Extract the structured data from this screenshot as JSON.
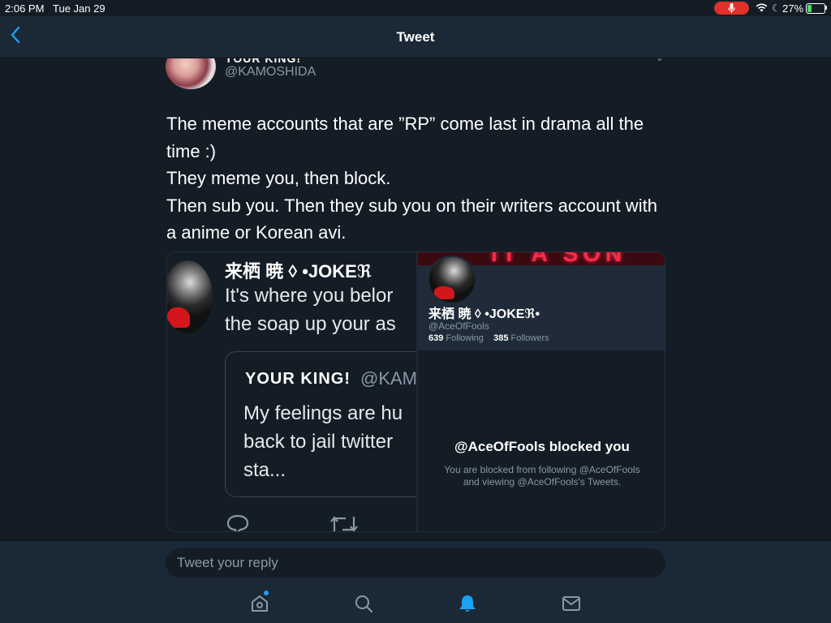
{
  "status_bar": {
    "time": "2:06 PM",
    "date": "Tue Jan 29",
    "battery_percent": "27%",
    "battery_level": 0.27,
    "icons": [
      "microphone-icon",
      "wifi-icon",
      "moon-icon",
      "battery-charging-icon"
    ]
  },
  "nav": {
    "title": "Tweet",
    "back_icon": "chevron-left-icon"
  },
  "tweet": {
    "author_name": "YOUR KING!",
    "author_handle": "@KAMOSHIDA",
    "text_lines": [
      "The meme accounts that are ”RP” come last in drama all the",
      "time :)",
      "They meme you, then block.",
      "Then sub you. Then they sub you on their writers account with",
      "a anime or Korean avi."
    ]
  },
  "media_left": {
    "name": "来栖 暁 ◊ •JOKEℜ",
    "text1": "It's where you belor",
    "text2": "the soap up your as",
    "quote": {
      "name": "YOUR KING!",
      "handle": "@KAM",
      "text1": "My feelings are hu",
      "text2": "back to jail twitter",
      "text3": "sta..."
    }
  },
  "media_right": {
    "banner_text": "IT A SON",
    "name": "来栖 暁 ◊ •JOKEℜ•",
    "handle": "@AceOfFools",
    "following_count": "639",
    "following_label": "Following",
    "followers_count": "385",
    "followers_label": "Followers",
    "blocked_title": "@AceOfFools blocked you",
    "blocked_desc": "You are blocked from following @AceOfFools and viewing @AceOfFools's Tweets."
  },
  "reply": {
    "placeholder": "Tweet your reply"
  },
  "tabs": [
    "home-icon",
    "search-icon",
    "notifications-icon",
    "messages-icon"
  ],
  "colors": {
    "background": "#141d26",
    "bar": "#1b2836",
    "accent": "#1da1f2",
    "muted": "#8899a6",
    "record": "#e0302b"
  }
}
